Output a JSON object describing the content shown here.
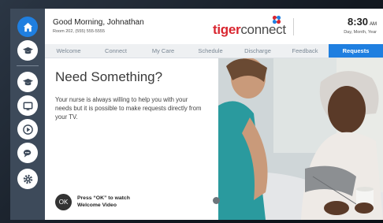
{
  "header": {
    "greeting": "Good Morning, Johnathan",
    "room": "Room 202, (555) 555-5555",
    "logo_tiger": "tiger",
    "logo_connect": "connect",
    "time": "8:30",
    "ampm": "AM",
    "date": "Day, Month, Year"
  },
  "nav": {
    "tabs": [
      {
        "label": "Welcome",
        "active": false
      },
      {
        "label": "Connect",
        "active": false
      },
      {
        "label": "My Care",
        "active": false
      },
      {
        "label": "Schedule",
        "active": false
      },
      {
        "label": "Discharge",
        "active": false
      },
      {
        "label": "Feedback",
        "active": false
      },
      {
        "label": "Requests",
        "active": true
      }
    ]
  },
  "sidebar": {
    "items": [
      {
        "icon": "home-icon",
        "active": true
      },
      {
        "icon": "graduation-cap-icon",
        "active": false
      },
      {
        "icon": "graduation-cap-icon",
        "active": false
      },
      {
        "icon": "tv-icon",
        "active": false
      },
      {
        "icon": "play-icon",
        "active": false
      },
      {
        "icon": "chat-icon",
        "active": false
      },
      {
        "icon": "gear-icon",
        "active": false
      }
    ]
  },
  "main": {
    "heading": "Need Something?",
    "body": "Your nurse is always willing to help you with your needs but it is possible to make requests directly from your TV.",
    "ok_label": "OK",
    "ok_line1": "Press “OK” to watch",
    "ok_line2": "Welcome Video"
  },
  "colors": {
    "accent": "#1f7fe0",
    "brand_red": "#d92630",
    "sidebar": "#3d4a5a"
  }
}
